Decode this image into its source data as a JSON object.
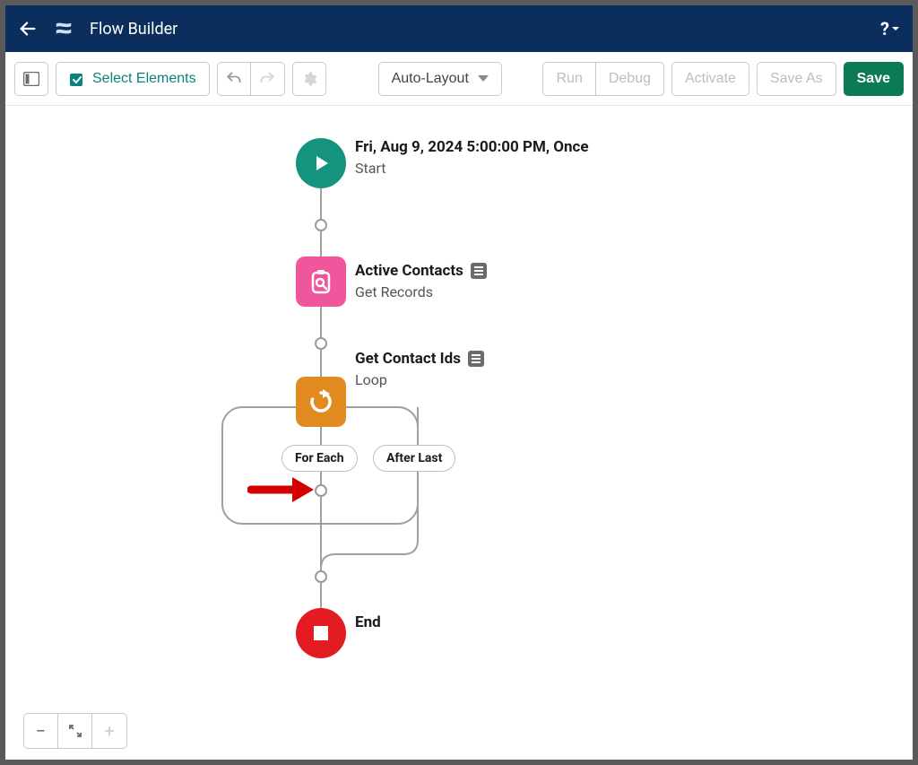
{
  "header": {
    "title": "Flow Builder"
  },
  "toolbar": {
    "select_elements": "Select Elements",
    "layout_mode": "Auto-Layout",
    "run": "Run",
    "debug": "Debug",
    "activate": "Activate",
    "save_as": "Save As",
    "save": "Save"
  },
  "nodes": {
    "start": {
      "title": "Fri, Aug 9, 2024 5:00:00 PM, Once",
      "subtitle": "Start"
    },
    "records": {
      "title": "Active Contacts",
      "subtitle": "Get Records"
    },
    "loop": {
      "title": "Get Contact Ids",
      "subtitle": "Loop",
      "branches": {
        "for_each": "For Each",
        "after_last": "After Last"
      }
    },
    "end": {
      "title": "End"
    }
  },
  "zoom": {
    "minus": "−",
    "plus": "+"
  },
  "help": "?"
}
